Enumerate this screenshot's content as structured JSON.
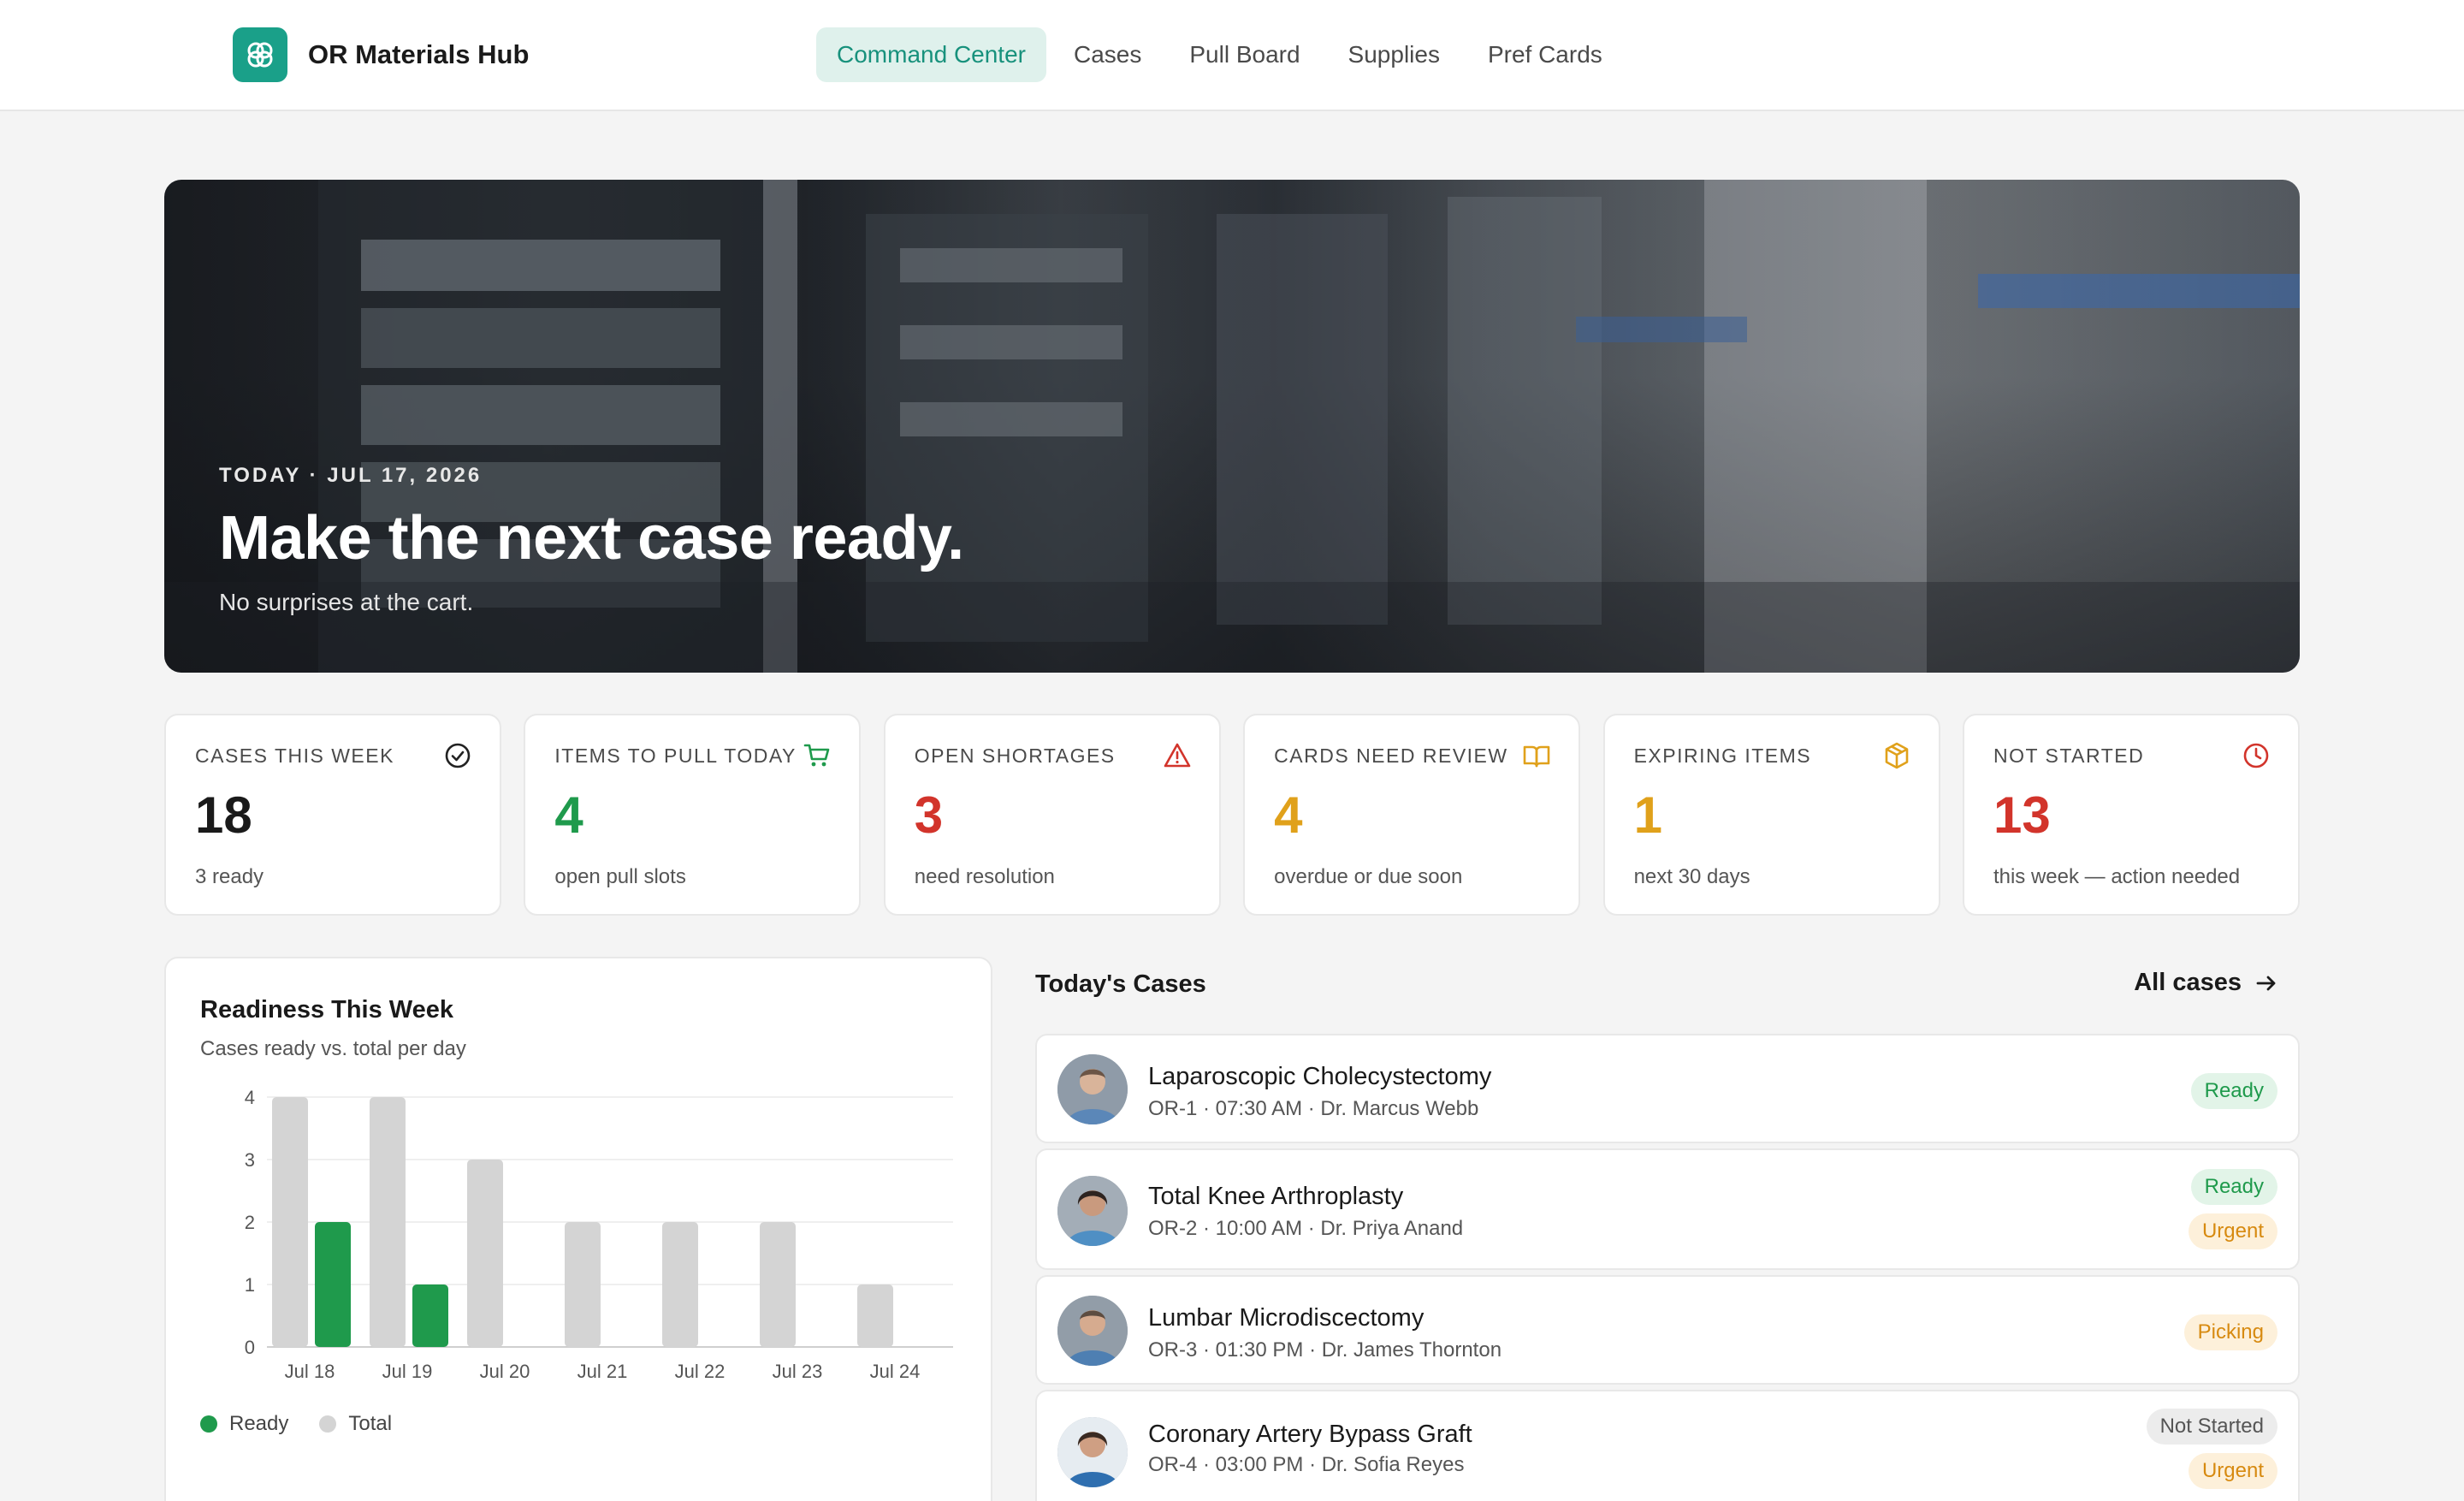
{
  "app": {
    "name": "OR Materials Hub"
  },
  "nav": {
    "items": [
      {
        "label": "Command Center",
        "active": true
      },
      {
        "label": "Cases",
        "active": false
      },
      {
        "label": "Pull Board",
        "active": false
      },
      {
        "label": "Supplies",
        "active": false
      },
      {
        "label": "Pref Cards",
        "active": false
      }
    ]
  },
  "hero": {
    "eyebrow": "TODAY · JUL 17, 2026",
    "title": "Make the next case ready.",
    "subtitle": "No surprises at the cart."
  },
  "stats": [
    {
      "label": "CASES THIS WEEK",
      "value": "18",
      "note": "3 ready",
      "icon": "check-circle-icon",
      "color": "#1a1a1a"
    },
    {
      "label": "ITEMS TO PULL TODAY",
      "value": "4",
      "note": "open pull slots",
      "icon": "cart-icon",
      "color": "#1f9a4c"
    },
    {
      "label": "OPEN SHORTAGES",
      "value": "3",
      "note": "need resolution",
      "icon": "warning-triangle-icon",
      "color": "#d2342b"
    },
    {
      "label": "CARDS NEED REVIEW",
      "value": "4",
      "note": "overdue or due soon",
      "icon": "open-book-icon",
      "color": "#e0a11b"
    },
    {
      "label": "EXPIRING ITEMS",
      "value": "1",
      "note": "next 30 days",
      "icon": "package-icon",
      "color": "#e0a11b"
    },
    {
      "label": "NOT STARTED",
      "value": "13",
      "note": "this week — action needed",
      "icon": "clock-icon",
      "color": "#d2342b"
    }
  ],
  "readiness": {
    "title": "Readiness This Week",
    "subtitle": "Cases ready vs. total per day",
    "legend": {
      "ready": "Ready",
      "total": "Total"
    }
  },
  "chart_data": {
    "type": "bar",
    "title": "Readiness This Week",
    "subtitle": "Cases ready vs. total per day",
    "categories": [
      "Jul 18",
      "Jul 19",
      "Jul 20",
      "Jul 21",
      "Jul 22",
      "Jul 23",
      "Jul 24"
    ],
    "series": [
      {
        "name": "Total",
        "values": [
          4,
          4,
          3,
          2,
          2,
          2,
          1
        ],
        "color": "#d4d4d4"
      },
      {
        "name": "Ready",
        "values": [
          2,
          1,
          0,
          0,
          0,
          0,
          0
        ],
        "color": "#1f9a4c"
      }
    ],
    "yticks": [
      0,
      1,
      2,
      3,
      4
    ],
    "ylim": [
      0,
      4
    ],
    "grid": true,
    "legend": "bottom-left"
  },
  "cases": {
    "title": "Today's Cases",
    "all_link": "All cases",
    "items": [
      {
        "name": "Laparoscopic Cholecystectomy",
        "meta": "OR-1 · 07:30 AM · Dr. Marcus Webb",
        "badges": [
          {
            "text": "Ready",
            "kind": "ready"
          }
        ]
      },
      {
        "name": "Total Knee Arthroplasty",
        "meta": "OR-2 · 10:00 AM · Dr. Priya Anand",
        "badges": [
          {
            "text": "Ready",
            "kind": "ready"
          },
          {
            "text": "Urgent",
            "kind": "urgent"
          }
        ]
      },
      {
        "name": "Lumbar Microdiscectomy",
        "meta": "OR-3 · 01:30 PM · Dr. James Thornton",
        "badges": [
          {
            "text": "Picking",
            "kind": "picking"
          }
        ]
      },
      {
        "name": "Coronary Artery Bypass Graft",
        "meta": "OR-4 · 03:00 PM · Dr. Sofia Reyes",
        "badges": [
          {
            "text": "Not Started",
            "kind": "ns"
          },
          {
            "text": "Urgent",
            "kind": "urgent"
          }
        ]
      }
    ]
  }
}
